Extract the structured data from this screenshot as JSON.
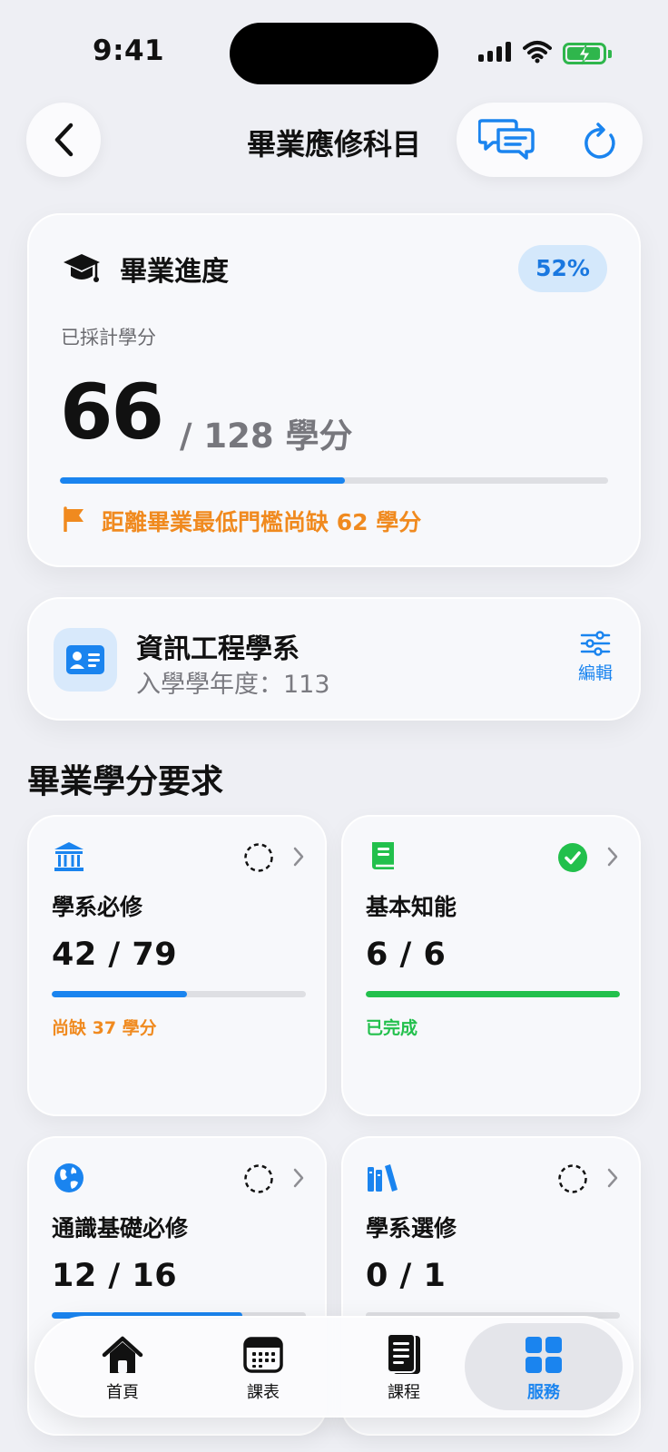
{
  "status_bar": {
    "time": "9:41"
  },
  "header": {
    "title": "畢業應修科目"
  },
  "progress": {
    "title": "畢業進度",
    "percent_label": "52%",
    "percent": 52,
    "earned_label": "已採計學分",
    "earned": "66",
    "total_text": "/ 128 學分",
    "warning": "距離畢業最低門檻尚缺 62 學分"
  },
  "department": {
    "name": "資訊工程學系",
    "enroll_year": "入學學年度：113",
    "edit_label": "編輯"
  },
  "section_title": "畢業學分要求",
  "requirements": [
    {
      "name": "學系必修",
      "count": "42 / 79",
      "progress": 0.532,
      "note": "尚缺 37 學分",
      "status": "incomplete",
      "icon": "bank-icon",
      "color": "#1a84ef",
      "note_color": "#f08a1f"
    },
    {
      "name": "基本知能",
      "count": "6 / 6",
      "progress": 1.0,
      "note": "已完成",
      "status": "complete",
      "icon": "book-icon",
      "color": "#22c04c",
      "note_color": "#22c04c"
    },
    {
      "name": "通識基礎必修",
      "count": "12 / 16",
      "progress": 0.75,
      "note": "",
      "status": "incomplete",
      "icon": "globe-icon",
      "color": "#1a84ef",
      "note_color": "#f08a1f"
    },
    {
      "name": "學系選修",
      "count": "0 / 1",
      "progress": 0.0,
      "note": "",
      "status": "incomplete",
      "icon": "books-icon",
      "color": "#1a84ef",
      "note_color": "#f08a1f"
    }
  ],
  "tabs": [
    {
      "label": "首頁",
      "icon": "home-icon",
      "active": false
    },
    {
      "label": "課表",
      "icon": "calendar-icon",
      "active": false
    },
    {
      "label": "課程",
      "icon": "document-icon",
      "active": false
    },
    {
      "label": "服務",
      "icon": "grid-icon",
      "active": true
    }
  ]
}
